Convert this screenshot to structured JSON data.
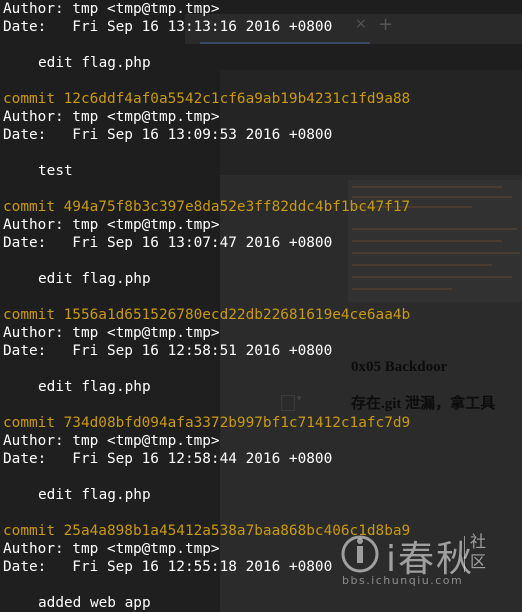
{
  "background": {
    "tab_close": "×",
    "tab_new": "+",
    "article_heading": "0x05 Backdoor",
    "article_subheading": "存在.git 泄漏，拿工具"
  },
  "terminal": {
    "lines": [
      {
        "kind": "author",
        "text": "Author: tmp <tmp@tmp.tmp>"
      },
      {
        "kind": "date",
        "text": "Date:   Fri Sep 16 13:13:16 2016 +0800"
      },
      {
        "kind": "blank",
        "text": ""
      },
      {
        "kind": "msg",
        "text": "edit flag.php"
      },
      {
        "kind": "blank",
        "text": ""
      },
      {
        "kind": "commit",
        "text": "commit 12c6ddf4af0a5542c1cf6a9ab19b4231c1fd9a88"
      },
      {
        "kind": "author",
        "text": "Author: tmp <tmp@tmp.tmp>"
      },
      {
        "kind": "date",
        "text": "Date:   Fri Sep 16 13:09:53 2016 +0800"
      },
      {
        "kind": "blank",
        "text": ""
      },
      {
        "kind": "msg",
        "text": "test"
      },
      {
        "kind": "blank",
        "text": ""
      },
      {
        "kind": "commit",
        "text": "commit 494a75f8b3c397e8da52e3ff82ddc4bf1bc47f17"
      },
      {
        "kind": "author",
        "text": "Author: tmp <tmp@tmp.tmp>"
      },
      {
        "kind": "date",
        "text": "Date:   Fri Sep 16 13:07:47 2016 +0800"
      },
      {
        "kind": "blank",
        "text": ""
      },
      {
        "kind": "msg",
        "text": "edit flag.php"
      },
      {
        "kind": "blank",
        "text": ""
      },
      {
        "kind": "commit",
        "text": "commit 1556a1d651526780ecd22db22681619e4ce6aa4b"
      },
      {
        "kind": "author",
        "text": "Author: tmp <tmp@tmp.tmp>"
      },
      {
        "kind": "date",
        "text": "Date:   Fri Sep 16 12:58:51 2016 +0800"
      },
      {
        "kind": "blank",
        "text": ""
      },
      {
        "kind": "msg",
        "text": "edit flag.php"
      },
      {
        "kind": "blank",
        "text": ""
      },
      {
        "kind": "commit",
        "text": "commit 734d08bfd094afa3372b997bf1c71412c1afc7d9"
      },
      {
        "kind": "author",
        "text": "Author: tmp <tmp@tmp.tmp>"
      },
      {
        "kind": "date",
        "text": "Date:   Fri Sep 16 12:58:44 2016 +0800"
      },
      {
        "kind": "blank",
        "text": ""
      },
      {
        "kind": "msg",
        "text": "edit flag.php"
      },
      {
        "kind": "blank",
        "text": ""
      },
      {
        "kind": "commit",
        "text": "commit 25a4a898b1a45412a538a7baa868bc406c1d8ba9"
      },
      {
        "kind": "author",
        "text": "Author: tmp <tmp@tmp.tmp>"
      },
      {
        "kind": "date",
        "text": "Date:   Fri Sep 16 12:55:18 2016 +0800"
      },
      {
        "kind": "blank",
        "text": ""
      },
      {
        "kind": "msg",
        "text": "added web app"
      }
    ]
  },
  "watermark": {
    "brand": "i春秋",
    "side_text": "社\n区",
    "url": "bbs.ichunqiu.com"
  },
  "colors": {
    "commit_hash": "#c89a0c",
    "terminal_text": "#ffffff",
    "terminal_bg": "#1b1b1b"
  }
}
